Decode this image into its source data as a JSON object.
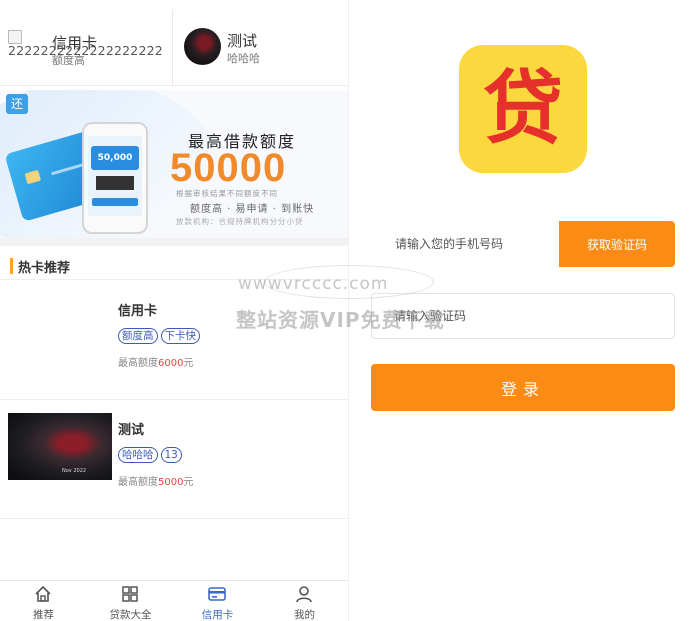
{
  "left": {
    "top_cards": [
      {
        "image_alt": "2222222222222222222",
        "title": "信用卡",
        "subtitle": "额度高"
      },
      {
        "title": "测试",
        "subtitle": "哈哈哈"
      }
    ],
    "banner": {
      "badge": "还",
      "phone_amount": "50,000",
      "title": "最高借款额度",
      "amount": "50000",
      "small_line": "根据审核结果不同额度不同",
      "tagline": "额度高 · 易申请 · 到账快",
      "small_line2": "放款机构：合规持牌机构分分小贷"
    },
    "section_title": "热卡推荐",
    "items": [
      {
        "title": "信用卡",
        "tags": [
          "额度高",
          "下卡快"
        ],
        "limit_label": "最高额度",
        "limit_amount": "6000",
        "limit_unit": "元"
      },
      {
        "title": "测试",
        "tags": [
          "哈哈哈",
          "13"
        ],
        "limit_label": "最高额度",
        "limit_amount": "5000",
        "limit_unit": "元",
        "thumb_caption": "Nov 2022"
      }
    ],
    "tabbar": [
      {
        "label": "推荐",
        "icon": "home-icon",
        "active": false
      },
      {
        "label": "贷款大全",
        "icon": "grid-icon",
        "active": false
      },
      {
        "label": "信用卡",
        "icon": "credit-card-icon",
        "active": true
      },
      {
        "label": "我的",
        "icon": "user-icon",
        "active": false
      }
    ]
  },
  "right": {
    "logo_text": "贷",
    "phone_placeholder": "请输入您的手机号码",
    "get_code_label": "获取验证码",
    "code_placeholder": "请输入验证码",
    "login_label": "登录"
  },
  "watermark": {
    "url": "wwwvrcccc.com",
    "text": "整站资源VIP免费下载"
  },
  "colors": {
    "orange": "#fa8c16",
    "logo_yellow": "#fbd83e",
    "logo_red": "#e5302b",
    "active_tab": "#3a68c8",
    "tag_blue": "#3c5bb8",
    "amount_red": "#e5483d"
  }
}
